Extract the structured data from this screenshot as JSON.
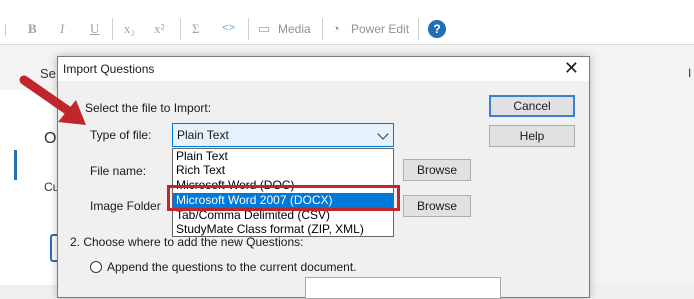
{
  "toolbar": {
    "media_label": "Media",
    "power_edit_label": "Power Edit",
    "bold": "B",
    "italic": "I",
    "underline": "U",
    "subscript": "x₂",
    "superscript": "x²",
    "sigma": "Σ",
    "code": "<>",
    "help": "?"
  },
  "background": {
    "frag_settings": "Se",
    "frag_o": "O",
    "frag_cu": "Cu",
    "frag_right": "I"
  },
  "dialog": {
    "title": "Import Questions",
    "step1_label": "Select the file to Import:",
    "type_label": "Type of file:",
    "type_value": "Plain Text",
    "file_name_label": "File name:",
    "image_folder_label": "Image Folder",
    "step2_label": "2.  Choose where to add the new Questions:",
    "append_option": "Append the questions to the current document.",
    "cancel_label": "Cancel",
    "help_label": "Help",
    "browse_label": "Browse",
    "browse2_label": "Browse",
    "options": [
      "Plain Text",
      "Rich Text",
      "Microsoft Word (DOC)",
      "Microsoft Word 2007 (DOCX)",
      "Tab/Comma Delimited (CSV)",
      "StudyMate Class format (ZIP, XML)"
    ],
    "selected_option": "Microsoft Word 2007 (DOCX)"
  },
  "colors": {
    "selection": "#0078d7",
    "annotation_red": "#c0272d"
  }
}
